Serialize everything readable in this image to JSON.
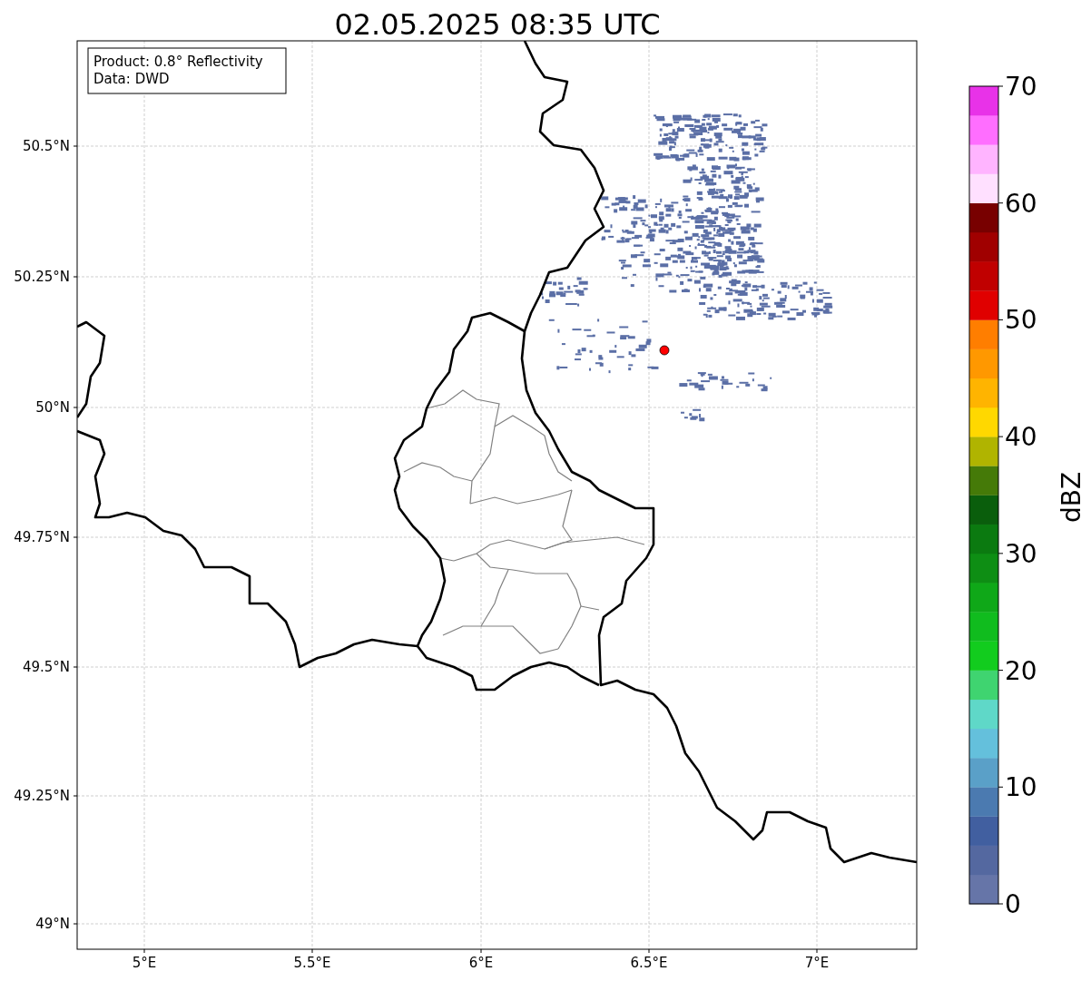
{
  "title": "02.05.2025 08:35 UTC",
  "info_box": {
    "lines": [
      "Product: 0.8° Reflectivity",
      "Data: DWD"
    ]
  },
  "map": {
    "x_ticks": [
      "5°E",
      "5.5°E",
      "6°E",
      "6.5°E",
      "7°E"
    ],
    "y_ticks": [
      "50.5°N",
      "50.25°N",
      "50°N",
      "49.75°N",
      "49.5°N",
      "49.25°N",
      "49°N"
    ]
  },
  "colorbar": {
    "label": "dBZ",
    "ticks": [
      "70",
      "60",
      "50",
      "40",
      "30",
      "20",
      "10",
      "0"
    ],
    "bins": [
      {
        "color": "#6675a8"
      },
      {
        "color": "#5468a0"
      },
      {
        "color": "#415fa0"
      },
      {
        "color": "#4b7ab0"
      },
      {
        "color": "#5aa0c8"
      },
      {
        "color": "#64c0dc"
      },
      {
        "color": "#5fd8c8"
      },
      {
        "color": "#3fd470"
      },
      {
        "color": "#12cc1e"
      },
      {
        "color": "#10bc1e"
      },
      {
        "color": "#0fa818"
      },
      {
        "color": "#0e8e14"
      },
      {
        "color": "#0b7a10"
      },
      {
        "color": "#0a5e0c"
      },
      {
        "color": "#457a08"
      },
      {
        "color": "#b0b400"
      },
      {
        "color": "#ffd800"
      },
      {
        "color": "#ffb400"
      },
      {
        "color": "#ff9800"
      },
      {
        "color": "#ff7e00"
      },
      {
        "color": "#e00000"
      },
      {
        "color": "#c00000"
      },
      {
        "color": "#a00000"
      },
      {
        "color": "#780000"
      },
      {
        "color": "#ffe0ff"
      },
      {
        "color": "#ffb4ff"
      },
      {
        "color": "#ff6eff"
      },
      {
        "color": "#e832e8"
      }
    ]
  }
}
